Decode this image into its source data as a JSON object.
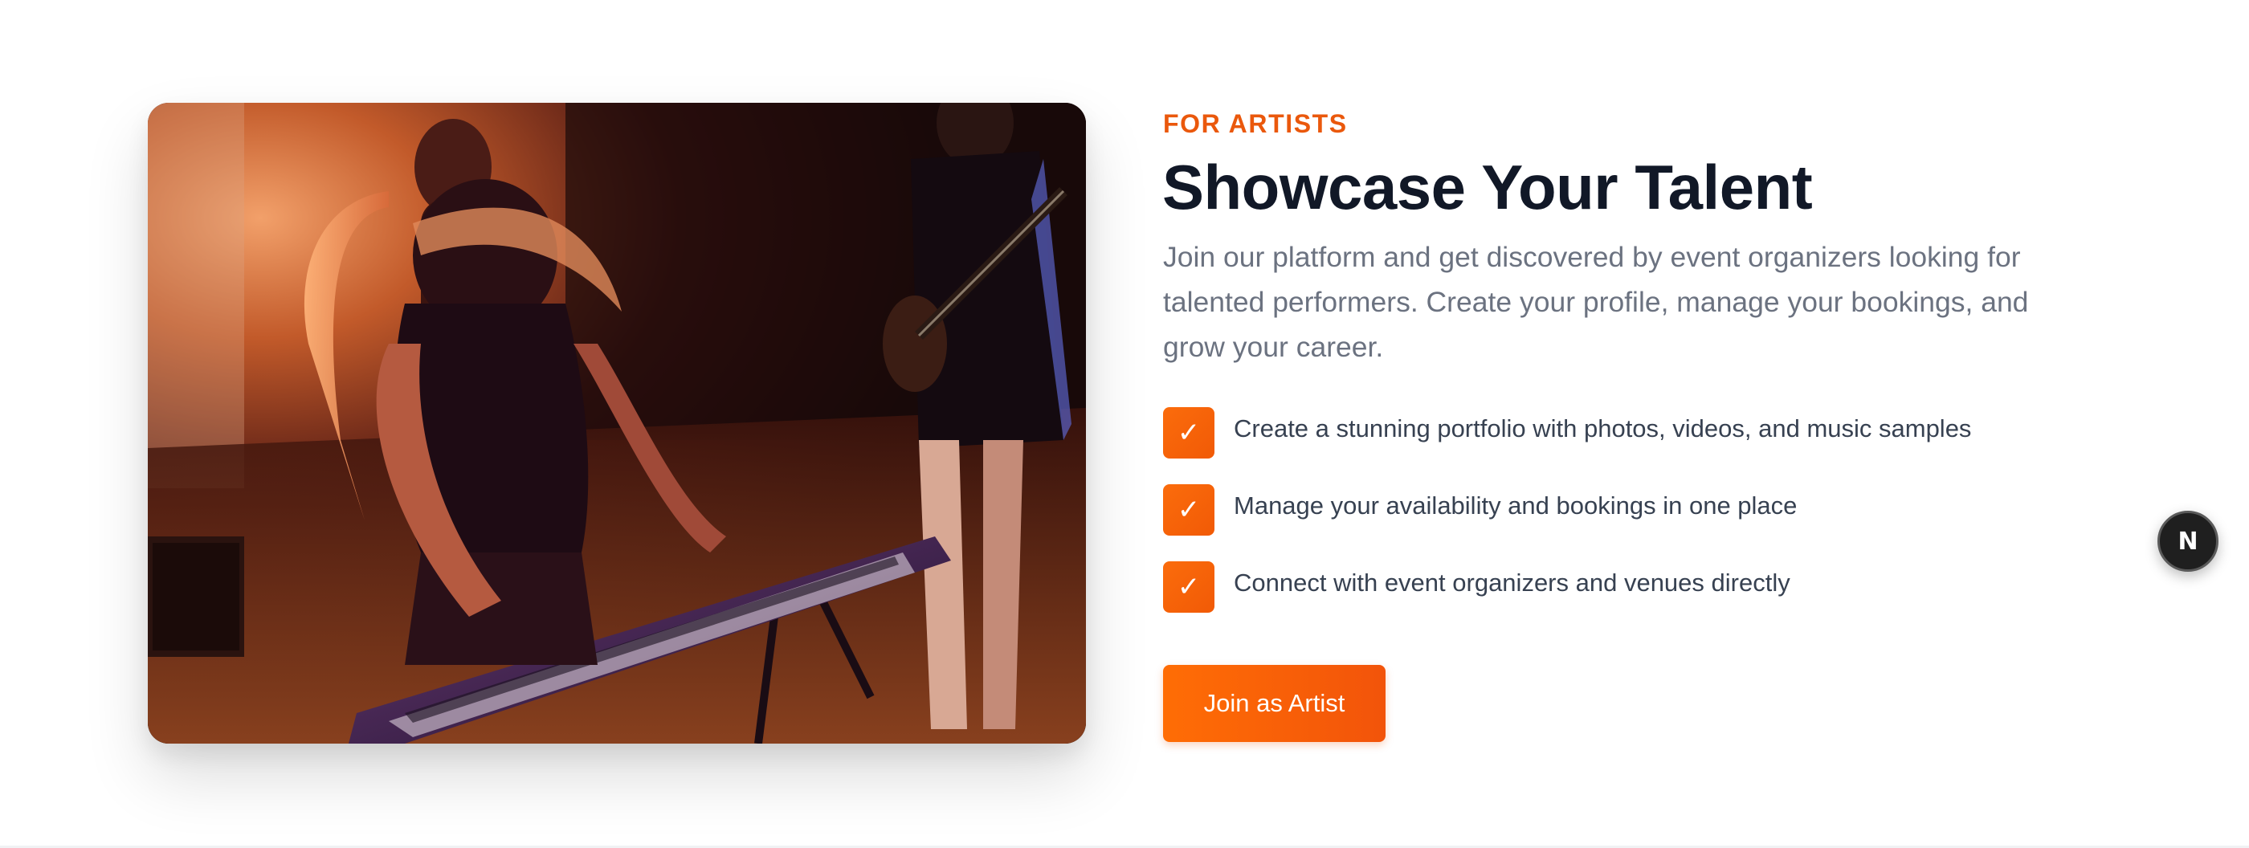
{
  "section": {
    "eyebrow": "FOR ARTISTS",
    "title": "Showcase Your Talent",
    "description": "Join our platform and get discovered by event organizers looking for talented performers. Create your profile, manage your bookings, and grow your career.",
    "features": [
      {
        "icon": "check-icon",
        "glyph": "✓",
        "text": "Create a stunning portfolio with photos, videos, and music samples"
      },
      {
        "icon": "check-icon",
        "glyph": "✓",
        "text": "Manage your availability and bookings in one place"
      },
      {
        "icon": "check-icon",
        "glyph": "✓",
        "text": "Connect with event organizers and venues directly"
      }
    ],
    "cta_label": "Join as Artist",
    "image": {
      "subject": "keyboardist-and-guitarist-performing-under-orange-stage-lights",
      "alt": "Keyboardist and guitarist performing on stage"
    }
  },
  "dev_badge": {
    "icon": "nextjs-logo-icon",
    "glyph": "N"
  },
  "colors": {
    "accent": "#ea580c",
    "accent_gradient_start": "#ff6d05",
    "accent_gradient_end": "#f2540a",
    "heading": "#111827",
    "body_text": "#6b7280",
    "feature_text": "#374151",
    "background": "#ffffff"
  }
}
